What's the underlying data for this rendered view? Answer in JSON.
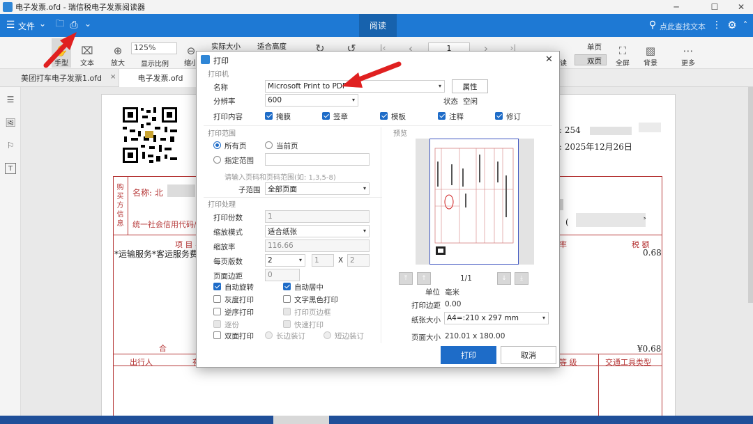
{
  "window": {
    "title": "电子发票.ofd - 瑞信税电子发票阅读器",
    "min": "─",
    "max": "☐",
    "close": "✕"
  },
  "menubar": {
    "menu_label": "文件",
    "menu_icon": "☰",
    "chevron": "⌄",
    "folder_icon": "🗀",
    "print_icon": "⎙",
    "dropdown_icon": "⌄",
    "active_tab": "阅读",
    "search_placeholder": "点此查找文本",
    "search_icon": "⚲",
    "more_icon": "⋮",
    "settings_icon": "⚙",
    "chevron_up": "˄"
  },
  "toolbar": {
    "hand": "手型",
    "text": "文本",
    "zoom_in": "放大",
    "zoom_value": "125%",
    "show_ratio": "显示比例",
    "zoom_out": "缩小",
    "actual_size": "实际大小",
    "fit_height": "适合高度",
    "page_number": "1",
    "single_page": "单页",
    "double_page": "双页",
    "read_partial": "读",
    "fullscreen": "全屏",
    "background": "背景",
    "more": "更多",
    "symbols": {
      "zoom_in": "⊕",
      "zoom_out": "⊖",
      "rotate_left": "↻",
      "rotate_right": "↺",
      "first": "|‹",
      "prev": "‹",
      "next": "›",
      "last": "›|",
      "more": "⋯",
      "fullscreen": "⛶",
      "background": "▧"
    }
  },
  "tabs": [
    {
      "label": "美团打车电子发票1.ofd",
      "close": "×"
    },
    {
      "label": "电子发票.ofd",
      "close": "×"
    }
  ],
  "sidebar": {
    "icons": [
      "☰",
      "🖼",
      "⚐",
      "T"
    ]
  },
  "invoice": {
    "buyer_vertical": [
      "购",
      "买",
      "方",
      "信",
      "息"
    ],
    "name_label": "名称: 北",
    "tax_code_label": "统一社会信用代码/",
    "item_header": "项 目 名 称",
    "item_row": "*运输服务*客运服务费",
    "number_prefix": ": 254",
    "date_text": ": 2025年12月26日",
    "rate_header": "率",
    "tax_header": "税 额",
    "tax_value": "0.68",
    "total_label": "合",
    "total_tax": "¥0.68",
    "traveler_header": "出行人",
    "traveler_col2": "有",
    "level_header": "等 级",
    "vehicle_header": "交通工具类型",
    "paren": "(",
    "arrow": "˃"
  },
  "dialog": {
    "title": "打印",
    "close": "✕",
    "printer_section": "打印机",
    "name_label": "名称",
    "printer_name": "Microsoft Print to PDF",
    "properties_button": "属性",
    "resolution_label": "分辨率",
    "resolution_value": "600",
    "status_label": "状态",
    "status_value": "空闲",
    "content_label": "打印内容",
    "content_options": [
      "掩膜",
      "签章",
      "模板",
      "注释",
      "修订"
    ],
    "range_section": "打印范围",
    "all_pages": "所有页",
    "current_page": "当前页",
    "specified_range": "指定范围",
    "range_hint": "请输入页码和页码范围(如: 1,3,5-8)",
    "subrange_label": "子范围",
    "subrange_value": "全部页面",
    "processing_section": "打印处理",
    "copies_label": "打印份数",
    "copies_value": "1",
    "scale_mode_label": "缩放模式",
    "scale_mode_value": "适合纸张",
    "scale_ratio_label": "缩放率",
    "scale_ratio_value": "116.66",
    "pages_per_sheet_label": "每页版数",
    "pps_value": "2",
    "pps_x": "1",
    "pps_times": "X",
    "pps_y": "2",
    "margin_label": "页面边距",
    "margin_value": "0",
    "auto_rotate": "自动旋转",
    "auto_center": "自动居中",
    "grayscale": "灰度打印",
    "text_black": "文字黑色打印",
    "reverse": "逆序打印",
    "print_border": "打印页边框",
    "collate": "逐份",
    "quick_print": "快速打印",
    "duplex": "双面打印",
    "long_edge": "长边装订",
    "short_edge": "短边装订",
    "preview_section": "预览",
    "page_counter": "1/1",
    "unit_label": "单位",
    "unit_value": "毫米",
    "print_margin_label": "打印边距",
    "print_margin_value": "0.00",
    "paper_size_label": "纸张大小",
    "paper_size_value": "A4=:210 x 297 mm",
    "page_size_label": "页面大小",
    "page_size_value": "210.01 x 180.00",
    "print_button": "打印",
    "cancel_button": "取消",
    "nav_symbols": {
      "first": "⤒",
      "up": "↑",
      "down": "↓",
      "last": "⤓"
    }
  },
  "colors": {
    "accent": "#1e79d4",
    "primary_button": "#1e6cc8",
    "annotation_arrow": "#e02020",
    "invoice_red": "#b53636"
  }
}
